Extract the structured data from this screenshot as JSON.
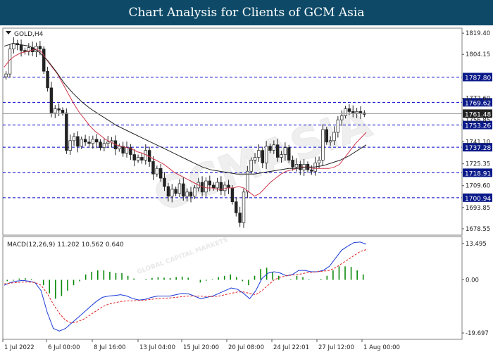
{
  "banner": {
    "title": "Chart Analysis for Clients of GCM Asia"
  },
  "watermark": {
    "text": "GCMASIA",
    "tagline": "GLOBAL CAPITAL MARKETS"
  },
  "colors": {
    "banner_bg": "#0e4a68",
    "bull_candle": "#0a8a0a",
    "bear_candle": "#b00000",
    "ma_fast": "#d0384a",
    "ma_slow": "#222222",
    "macd_line": "#1a3ad8",
    "signal_line": "#e02020",
    "histogram": "#0a8a0a",
    "sr_lines": "#0000cc",
    "current_price_label": "#222222",
    "sr_label_bg": "#0a1a8a"
  },
  "chart_data": [
    {
      "type": "candlestick",
      "title": "GOLD,H4",
      "ylim": [
        1675,
        1822
      ],
      "price_ticks": [
        "1819.40",
        "1804.15",
        "1772.60",
        "1756.85",
        "1741.10",
        "1725.35",
        "1709.60",
        "1693.85",
        "1678.55"
      ],
      "x_tick_labels": [
        "1 Jul 2022",
        "6 Jul 00:00",
        "8 Jul 16:00",
        "13 Jul 04:00",
        "15 Jul 20:00",
        "20 Jul 08:00",
        "24 Jul 22:01",
        "27 Jul 12:00",
        "1 Aug 00:00"
      ],
      "current_price": "1761.48",
      "support_resistance": [
        {
          "value": 1787.8,
          "label": "1787.80"
        },
        {
          "value": 1769.62,
          "label": "1769.62"
        },
        {
          "value": 1753.26,
          "label": "1753.26"
        },
        {
          "value": 1737.28,
          "label": "1737.28"
        },
        {
          "value": 1718.91,
          "label": "1718.91"
        },
        {
          "value": 1700.94,
          "label": "1700.94"
        }
      ],
      "close_path": [
        1790,
        1808,
        1812,
        1811,
        1807,
        1806,
        1809,
        1806,
        1810,
        1808,
        1792,
        1780,
        1762,
        1765,
        1764,
        1762,
        1735,
        1742,
        1745,
        1738,
        1743,
        1741,
        1740,
        1743,
        1741,
        1737,
        1740,
        1741,
        1742,
        1736,
        1738,
        1733,
        1737,
        1732,
        1728,
        1730,
        1728,
        1735,
        1727,
        1718,
        1722,
        1715,
        1709,
        1702,
        1707,
        1704,
        1711,
        1702,
        1705,
        1702,
        1708,
        1712,
        1705,
        1713,
        1710,
        1708,
        1712,
        1706,
        1710,
        1708,
        1698,
        1690,
        1683,
        1705,
        1720,
        1728,
        1730,
        1735,
        1726,
        1738,
        1735,
        1739,
        1730,
        1732,
        1737,
        1728,
        1723,
        1725,
        1721,
        1725,
        1721,
        1720,
        1726,
        1728,
        1750,
        1741,
        1742,
        1748,
        1757,
        1760,
        1765,
        1763,
        1762,
        1763,
        1762,
        1761
      ],
      "series": [
        {
          "name": "",
          "values": [
            1795,
            1800,
            1803,
            1805,
            1806,
            1807,
            1808,
            1806,
            1800,
            1795,
            1790,
            1783,
            1776,
            1769,
            1763,
            1758,
            1753,
            1749,
            1746,
            1743,
            1741,
            1739,
            1738,
            1737,
            1736,
            1734,
            1733,
            1731,
            1729,
            1727,
            1725,
            1722,
            1719,
            1717,
            1715,
            1713,
            1711,
            1709,
            1708,
            1708,
            1707,
            1707,
            1708,
            1708,
            1709,
            1708,
            1705,
            1702,
            1704,
            1708,
            1712,
            1715,
            1718,
            1720,
            1721,
            1722,
            1723,
            1723,
            1722,
            1722,
            1722,
            1722,
            1723,
            1725,
            1730,
            1735,
            1740,
            1744,
            1748
          ]
        },
        {
          "name": "",
          "values": [
            1810,
            1812,
            1811,
            1810,
            1806,
            1800,
            1792,
            1783,
            1776,
            1770,
            1765,
            1761,
            1757,
            1753,
            1750,
            1747,
            1744,
            1741,
            1738,
            1735,
            1732,
            1729,
            1726,
            1723,
            1721,
            1720,
            1719,
            1718,
            1718,
            1718,
            1719,
            1720,
            1721,
            1722,
            1722,
            1723,
            1723,
            1724,
            1726,
            1728,
            1731,
            1735,
            1739
          ]
        }
      ]
    },
    {
      "type": "line",
      "title": "MACD(12,26,9) 11.202 10.562 0.640",
      "ylim": [
        -21,
        15
      ],
      "y_tick_labels": [
        "13.495",
        "0.00",
        "-19.697"
      ],
      "series": [
        {
          "name": "",
          "values": [
            -2,
            -1,
            -0.5,
            -0.2,
            -0.5,
            -1,
            -4,
            -12,
            -18,
            -19,
            -18,
            -16,
            -14,
            -12,
            -10,
            -8,
            -6.5,
            -6,
            -5.8,
            -5.5,
            -6,
            -7,
            -7.5,
            -7.2,
            -6.5,
            -6,
            -6,
            -6,
            -5.5,
            -5,
            -5.2,
            -6,
            -7,
            -6.5,
            -6,
            -5,
            -4,
            -3,
            -3.5,
            -5,
            -7,
            -4,
            0.5,
            2.5,
            3,
            2.5,
            1.5,
            2,
            3.5,
            3.5,
            3,
            3,
            3.5,
            5,
            8,
            11,
            12.5,
            13.8,
            14,
            13.2
          ]
        },
        {
          "name": "",
          "values": [
            -1.5,
            -1.2,
            -1,
            -0.8,
            -0.8,
            -1,
            -2,
            -5,
            -9,
            -12.5,
            -15,
            -16,
            -15.5,
            -14.5,
            -13,
            -11.5,
            -10,
            -9,
            -8.5,
            -8,
            -7.8,
            -7.8,
            -7.6,
            -7.5,
            -7.2,
            -7,
            -6.8,
            -6.7,
            -6.5,
            -6.2,
            -6,
            -6,
            -6,
            -6.2,
            -6.2,
            -6,
            -5.5,
            -5,
            -4.5,
            -4.5,
            -5,
            -5.5,
            -4,
            -2,
            0,
            1,
            1.5,
            1.8,
            2,
            2.5,
            2.8,
            3,
            3.2,
            3.5,
            4.5,
            6,
            7.5,
            9,
            10.5,
            11.2
          ]
        },
        {
          "name": "",
          "type": "bar",
          "values": [
            -0.5,
            -0.3,
            0.5,
            0.6,
            0.3,
            0,
            -2,
            -5,
            -7,
            -6,
            -4,
            -2,
            -0.5,
            2,
            3,
            3.5,
            3.5,
            3,
            2.5,
            2.5,
            1.5,
            0.5,
            0,
            0.3,
            0.7,
            1,
            0.8,
            0.7,
            1,
            1.2,
            0.8,
            0,
            -1,
            -0.3,
            0.2,
            1,
            1.5,
            2,
            1,
            -0.5,
            -2,
            1.5,
            4,
            4.5,
            3,
            1.5,
            0,
            0.2,
            1.5,
            1,
            0.2,
            0,
            0.3,
            1.5,
            3.5,
            5,
            5,
            4.8,
            3.5,
            2
          ]
        }
      ]
    }
  ]
}
